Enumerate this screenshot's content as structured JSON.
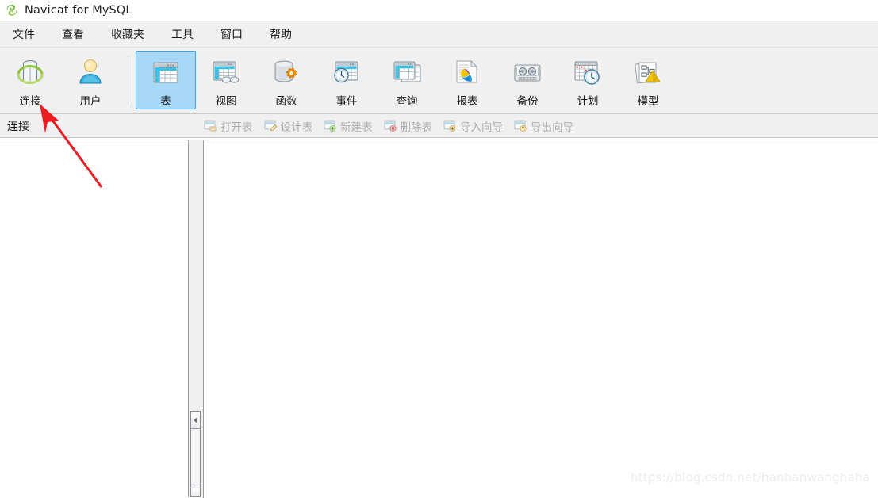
{
  "window": {
    "title": "Navicat for MySQL",
    "logo_icon": "navicat-leaf-logo"
  },
  "menubar": {
    "items": [
      {
        "label": "文件",
        "name": "menu-file"
      },
      {
        "label": "查看",
        "name": "menu-view"
      },
      {
        "label": "收藏夹",
        "name": "menu-favorites"
      },
      {
        "label": "工具",
        "name": "menu-tools"
      },
      {
        "label": "窗口",
        "name": "menu-window"
      },
      {
        "label": "帮助",
        "name": "menu-help"
      }
    ]
  },
  "toolbar": {
    "groups": [
      {
        "buttons": [
          {
            "label": "连接",
            "icon": "connection-cylinder-icon",
            "selected": false
          },
          {
            "label": "用户",
            "icon": "user-person-icon",
            "selected": false
          }
        ]
      },
      {
        "buttons": [
          {
            "label": "表",
            "icon": "table-grid-icon",
            "selected": true
          },
          {
            "label": "视图",
            "icon": "view-glasses-icon",
            "selected": false
          },
          {
            "label": "函数",
            "icon": "function-gear-database-icon",
            "selected": false
          },
          {
            "label": "事件",
            "icon": "event-clock-icon",
            "selected": false
          },
          {
            "label": "查询",
            "icon": "query-stacked-windows-icon",
            "selected": false
          },
          {
            "label": "报表",
            "icon": "report-piechart-document-icon",
            "selected": false
          },
          {
            "label": "备份",
            "icon": "backup-cassette-icon",
            "selected": false
          },
          {
            "label": "计划",
            "icon": "schedule-calendar-clock-icon",
            "selected": false
          },
          {
            "label": "模型",
            "icon": "model-diagram-icon",
            "selected": false
          }
        ]
      }
    ]
  },
  "actionbar": {
    "panel_header": "连接",
    "buttons": [
      {
        "label": "打开表",
        "icon": "open-table-icon",
        "disabled": true
      },
      {
        "label": "设计表",
        "icon": "design-table-icon",
        "disabled": true
      },
      {
        "label": "新建表",
        "icon": "new-table-icon",
        "disabled": true
      },
      {
        "label": "删除表",
        "icon": "delete-table-icon",
        "disabled": true
      },
      {
        "label": "导入向导",
        "icon": "import-wizard-icon",
        "disabled": true
      },
      {
        "label": "导出向导",
        "icon": "export-wizard-icon",
        "disabled": true
      }
    ]
  },
  "panes": {
    "left_pane_name": "connection-tree-pane",
    "right_pane_name": "object-list-pane",
    "splitter_name": "vertical-splitter"
  },
  "annotation": {
    "arrow_color": "#ee1d24",
    "arrow_name": "red-pointer-arrow",
    "points_to": "连接"
  },
  "watermark": {
    "text": "https://blog.csdn.net/hanhanwanghaha"
  },
  "colors": {
    "selection_fill": "#a8d8f8",
    "selection_border": "#3c9fe0",
    "chrome": "#f0f0f0",
    "disabled_text": "#a9a9a9"
  }
}
